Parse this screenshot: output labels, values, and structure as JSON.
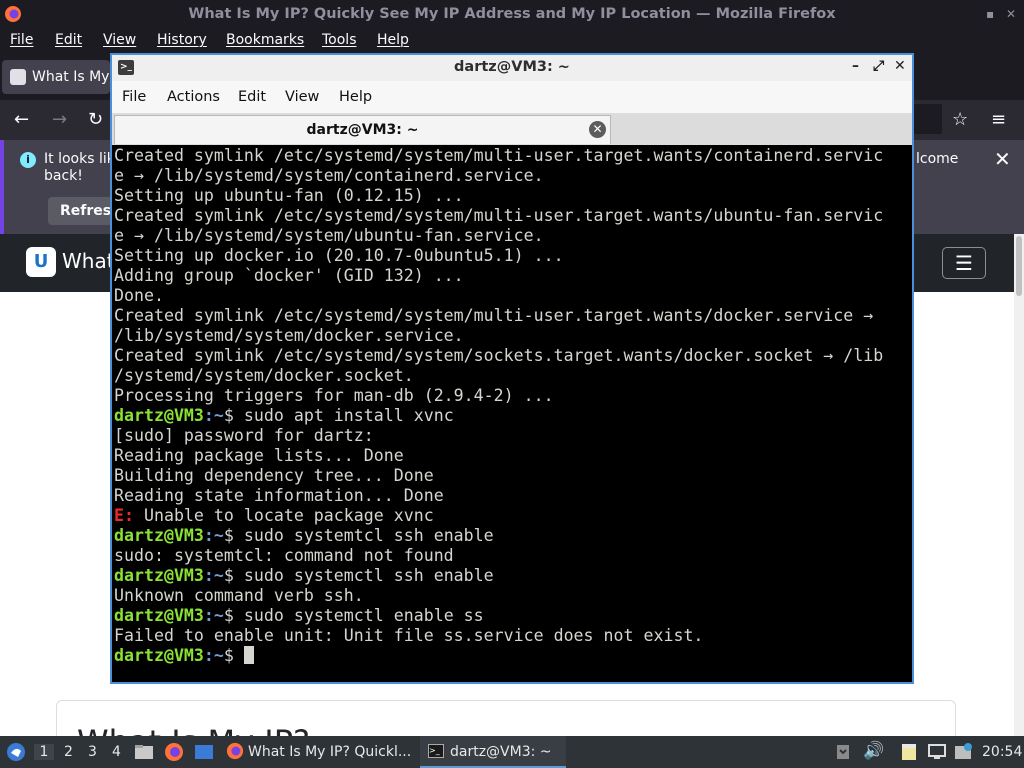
{
  "firefox": {
    "window_title": "What Is My IP? Quickly See My IP Address and My IP Location — Mozilla Firefox",
    "menu": [
      "File",
      "Edit",
      "View",
      "History",
      "Bookmarks",
      "Tools",
      "Help"
    ],
    "tab_label": "What Is My",
    "notification": {
      "text_line1": "It looks lik",
      "text_line2": "back!",
      "text_right": "lcome",
      "button_label": "Refresh"
    },
    "site": {
      "logo_letter": "U",
      "brand": "What",
      "heading": "What Is My IP?"
    }
  },
  "terminal": {
    "window_title": "dartz@VM3: ~",
    "menu": [
      "File",
      "Actions",
      "Edit",
      "View",
      "Help"
    ],
    "tab_label": "dartz@VM3: ~",
    "prompt_user": "dartz@VM3",
    "prompt_path": ":~",
    "lines": [
      {
        "type": "out",
        "text": "Created symlink /etc/systemd/system/multi-user.target.wants/containerd.servic"
      },
      {
        "type": "out",
        "text": "e → /lib/systemd/system/containerd.service."
      },
      {
        "type": "out",
        "text": "Setting up ubuntu-fan (0.12.15) ..."
      },
      {
        "type": "out",
        "text": "Created symlink /etc/systemd/system/multi-user.target.wants/ubuntu-fan.servic"
      },
      {
        "type": "out",
        "text": "e → /lib/systemd/system/ubuntu-fan.service."
      },
      {
        "type": "out",
        "text": "Setting up docker.io (20.10.7-0ubuntu5.1) ..."
      },
      {
        "type": "out",
        "text": "Adding group `docker' (GID 132) ..."
      },
      {
        "type": "out",
        "text": "Done."
      },
      {
        "type": "out",
        "text": "Created symlink /etc/systemd/system/multi-user.target.wants/docker.service →"
      },
      {
        "type": "out",
        "text": "/lib/systemd/system/docker.service."
      },
      {
        "type": "out",
        "text": "Created symlink /etc/systemd/system/sockets.target.wants/docker.socket → /lib"
      },
      {
        "type": "out",
        "text": "/systemd/system/docker.socket."
      },
      {
        "type": "out",
        "text": "Processing triggers for man-db (2.9.4-2) ..."
      },
      {
        "type": "cmd",
        "text": "$ sudo apt install xvnc"
      },
      {
        "type": "out",
        "text": "[sudo] password for dartz:"
      },
      {
        "type": "out",
        "text": "Reading package lists... Done"
      },
      {
        "type": "out",
        "text": "Building dependency tree... Done"
      },
      {
        "type": "out",
        "text": "Reading state information... Done"
      },
      {
        "type": "err",
        "tag": "E:",
        "text": " Unable to locate package xvnc"
      },
      {
        "type": "cmd",
        "text": "$ sudo systemtcl ssh enable"
      },
      {
        "type": "out",
        "text": "sudo: systemtcl: command not found"
      },
      {
        "type": "cmd",
        "text": "$ sudo systemctl ssh enable"
      },
      {
        "type": "out",
        "text": "Unknown command verb ssh."
      },
      {
        "type": "cmd",
        "text": "$ sudo systemctl enable ss"
      },
      {
        "type": "out",
        "text": "Failed to enable unit: Unit file ss.service does not exist."
      },
      {
        "type": "cursor",
        "text": "$ "
      }
    ]
  },
  "taskbar": {
    "workspaces": [
      "1",
      "2",
      "3",
      "4"
    ],
    "tasks": [
      {
        "label": "What Is My IP? Quickl...",
        "icon": "firefox-icon"
      },
      {
        "label": "dartz@VM3: ~",
        "icon": "terminal-icon"
      }
    ],
    "clock": "20:54"
  },
  "colors": {
    "prompt_green": "#8ae234",
    "prompt_blue": "#729fcf",
    "error_red": "#ef2929",
    "accent_blue": "#4a90d9"
  }
}
